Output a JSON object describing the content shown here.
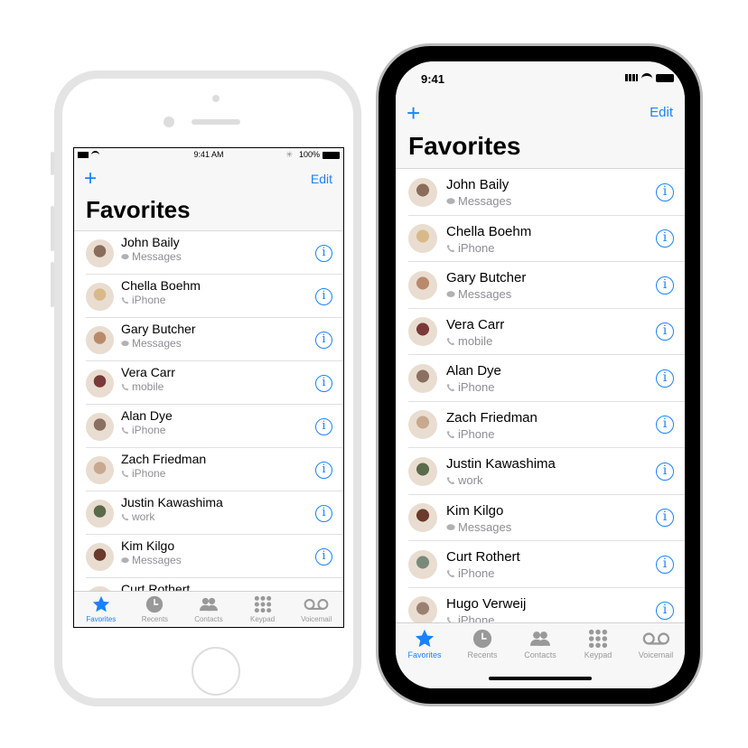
{
  "status": {
    "time_classic": "9:41 AM",
    "battery": "100%",
    "time_x": "9:41"
  },
  "nav": {
    "add": "+",
    "edit": "Edit",
    "title": "Favorites"
  },
  "contacts": [
    {
      "name": "John Baily",
      "sub": "Messages",
      "kind": "message",
      "color": "#8a6d5a"
    },
    {
      "name": "Chella Boehm",
      "sub": "iPhone",
      "kind": "phone",
      "color": "#d9b98a"
    },
    {
      "name": "Gary Butcher",
      "sub": "Messages",
      "kind": "message",
      "color": "#b98a6a"
    },
    {
      "name": "Vera Carr",
      "sub": "mobile",
      "kind": "phone",
      "color": "#7a3a3a"
    },
    {
      "name": "Alan Dye",
      "sub": "iPhone",
      "kind": "phone",
      "color": "#8a7060"
    },
    {
      "name": "Zach Friedman",
      "sub": "iPhone",
      "kind": "phone",
      "color": "#c8a890"
    },
    {
      "name": "Justin Kawashima",
      "sub": "work",
      "kind": "phone",
      "color": "#5a6a4a"
    },
    {
      "name": "Kim Kilgo",
      "sub": "Messages",
      "kind": "message",
      "color": "#6a3a2a"
    },
    {
      "name": "Curt Rothert",
      "sub": "iPhone",
      "kind": "phone",
      "color": "#7a8a7a"
    },
    {
      "name": "Hugo Verweij",
      "sub": "iPhone",
      "kind": "phone",
      "color": "#9a8070"
    }
  ],
  "tabs": [
    {
      "label": "Favorites",
      "icon": "star-icon",
      "active": true
    },
    {
      "label": "Recents",
      "icon": "clock-icon",
      "active": false
    },
    {
      "label": "Contacts",
      "icon": "contacts-icon",
      "active": false
    },
    {
      "label": "Keypad",
      "icon": "keypad-icon",
      "active": false
    },
    {
      "label": "Voicemail",
      "icon": "voicemail-icon",
      "active": false
    }
  ],
  "accent": "#1a82fb"
}
